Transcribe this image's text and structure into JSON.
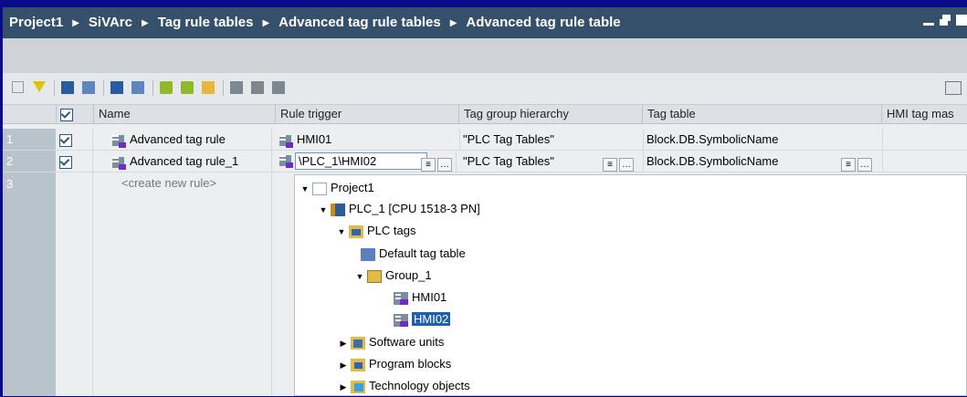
{
  "breadcrumb": [
    "Project1",
    "SiVArc",
    "Tag rule tables",
    "Advanced tag rule tables",
    "Advanced tag rule table"
  ],
  "table": {
    "columns": [
      "Name",
      "Rule trigger",
      "Tag group hierarchy",
      "Tag table",
      "HMI tag mas"
    ],
    "rows": [
      {
        "num": "1",
        "checked": true,
        "name": "Advanced tag rule",
        "rule_trigger": "HMI01",
        "hierarchy": "\"PLC Tag Tables\"",
        "tag_table": "Block.DB.SymbolicName"
      },
      {
        "num": "2",
        "checked": true,
        "name": "Advanced tag rule_1",
        "rule_trigger": "\\PLC_1\\HMI02",
        "hierarchy": "\"PLC Tag Tables\"",
        "tag_table": "Block.DB.SymbolicName"
      },
      {
        "num": "3",
        "name": "<create new rule>"
      }
    ]
  },
  "tree": {
    "project": "Project1",
    "plc": "PLC_1 [CPU 1518-3 PN]",
    "plc_tags": "PLC tags",
    "default_table": "Default tag table",
    "group": "Group_1",
    "tag1": "HMI01",
    "tag2": "HMI02",
    "software_units": "Software units",
    "program_blocks": "Program blocks",
    "technology_objects": "Technology objects"
  },
  "icons": [
    "filter-icon",
    "checkbox-icon",
    "tag-icon",
    "folder-icon",
    "plc-icon",
    "expand-arrow-icon",
    "collapse-arrow-icon"
  ],
  "colors": {
    "frame": "#0b0b8a",
    "titlebar": "#35506a",
    "selection": "#1f5fb0"
  }
}
